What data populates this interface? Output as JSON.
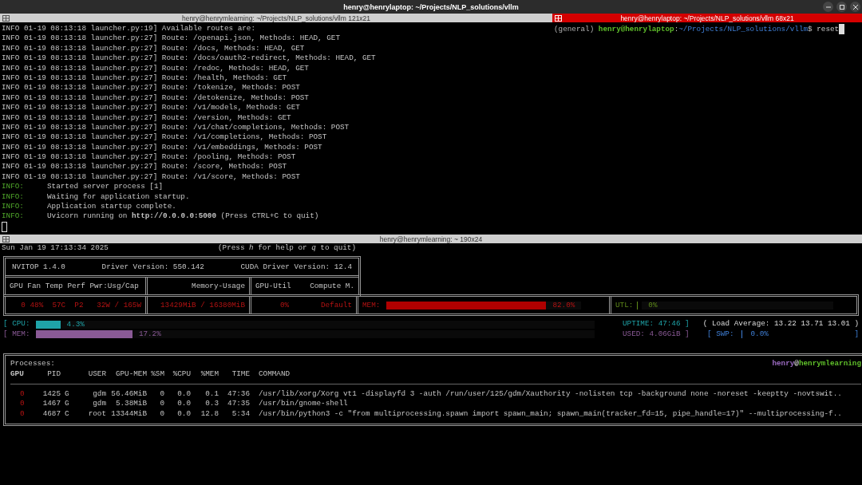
{
  "window": {
    "title": "henry@henrylaptop: ~/Projects/NLP_solutions/vllm"
  },
  "panes": [
    {
      "kind": "log",
      "title": "henry@henrymlearning: ~/Projects/NLP_solutions/vllm 121x21",
      "active": false,
      "lines": [
        {
          "kind": "log",
          "text": "INFO 01-19 08:13:18 launcher.py:19] Available routes are:"
        },
        {
          "kind": "log",
          "text": "INFO 01-19 08:13:18 launcher.py:27] Route: /openapi.json, Methods: HEAD, GET"
        },
        {
          "kind": "log",
          "text": "INFO 01-19 08:13:18 launcher.py:27] Route: /docs, Methods: HEAD, GET"
        },
        {
          "kind": "log",
          "text": "INFO 01-19 08:13:18 launcher.py:27] Route: /docs/oauth2-redirect, Methods: HEAD, GET"
        },
        {
          "kind": "log",
          "text": "INFO 01-19 08:13:18 launcher.py:27] Route: /redoc, Methods: HEAD, GET"
        },
        {
          "kind": "log",
          "text": "INFO 01-19 08:13:18 launcher.py:27] Route: /health, Methods: GET"
        },
        {
          "kind": "log",
          "text": "INFO 01-19 08:13:18 launcher.py:27] Route: /tokenize, Methods: POST"
        },
        {
          "kind": "log",
          "text": "INFO 01-19 08:13:18 launcher.py:27] Route: /detokenize, Methods: POST"
        },
        {
          "kind": "log",
          "text": "INFO 01-19 08:13:18 launcher.py:27] Route: /v1/models, Methods: GET"
        },
        {
          "kind": "log",
          "text": "INFO 01-19 08:13:18 launcher.py:27] Route: /version, Methods: GET"
        },
        {
          "kind": "log",
          "text": "INFO 01-19 08:13:18 launcher.py:27] Route: /v1/chat/completions, Methods: POST"
        },
        {
          "kind": "log",
          "text": "INFO 01-19 08:13:18 launcher.py:27] Route: /v1/completions, Methods: POST"
        },
        {
          "kind": "log",
          "text": "INFO 01-19 08:13:18 launcher.py:27] Route: /v1/embeddings, Methods: POST"
        },
        {
          "kind": "log",
          "text": "INFO 01-19 08:13:18 launcher.py:27] Route: /pooling, Methods: POST"
        },
        {
          "kind": "log",
          "text": "INFO 01-19 08:13:18 launcher.py:27] Route: /score, Methods: POST"
        },
        {
          "kind": "log",
          "text": "INFO 01-19 08:13:18 launcher.py:27] Route: /v1/score, Methods: POST"
        },
        {
          "kind": "server",
          "tag": "INFO:",
          "text": "Started server process [1]"
        },
        {
          "kind": "server",
          "tag": "INFO:",
          "text": "Waiting for application startup."
        },
        {
          "kind": "server",
          "tag": "INFO:",
          "text": "Application startup complete."
        },
        {
          "kind": "server",
          "tag": "INFO:",
          "text": "Uvicorn running on **http://0.0.0.0:5000** (Press CTRL+C to quit)"
        }
      ]
    },
    {
      "kind": "shell",
      "title": "henry@henrylaptop: ~/Projects/NLP_solutions/vllm 68x21",
      "active": true,
      "prompt": {
        "env": "(general)",
        "user_host": "henry@henrylaptop",
        "separator": ":",
        "path": "~/Projects/NLP_solutions/vllm",
        "symbol": "$",
        "command": "reset"
      }
    }
  ],
  "monitor": {
    "title": "henry@henrymlearning: ~ 190x24",
    "active": false,
    "clock": "Sun Jan 19 17:13:34 2025",
    "help": "(Press *h* for help or *q* to quit)",
    "summary": {
      "version": "NVITOP 1.4.0",
      "driver": "Driver Version: 550.142",
      "cuda": "CUDA Driver Version: 12.4"
    },
    "gpu_columns": {
      "status": "GPU Fan Temp Perf Pwr:Usg/Cap",
      "memory": "Memory-Usage",
      "util": "GPU-Util",
      "compute": "Compute M."
    },
    "gpu": {
      "status": "0 48%  57C  P2   32W / 165W",
      "memory": "13429MiB / 16380MiB",
      "util": "0%",
      "compute": "Default",
      "mem_meter": {
        "label": "MEM:",
        "level": 0.82,
        "reading": "82.0%"
      },
      "util_meter": {
        "label": "UTL:",
        "level": 0,
        "reading": "0%"
      }
    },
    "host_meters": [
      {
        "kind": "cpu",
        "label": "[ CPU:",
        "level": 0.043,
        "reading": "4.3%"
      },
      {
        "kind": "mem",
        "label": "[ MEM:",
        "level": 0.172,
        "reading": "17.2%"
      }
    ],
    "host_stats": {
      "uptime": "UPTIME: 47:46 ]",
      "load": "( Load Average: 13.22 13.71 13.01 )",
      "used": "USED: 4.06GiB ]",
      "swap": {
        "label": "[ SWP:",
        "reading": "0.0%",
        "end": "]"
      }
    },
    "processes": {
      "title": "Processes:",
      "user": "henry",
      "separator": "@",
      "host": "henrymlearning",
      "columns": [
        "GPU",
        "PID",
        "USER",
        "GPU-MEM",
        "%SM",
        "%CPU",
        "%MEM",
        "TIME",
        "COMMAND"
      ],
      "rows": [
        {
          "gpu": "0",
          "pid": "1425",
          "type": "G",
          "user": "gdm",
          "gpu_mem": "56.46MiB",
          "sm": "0",
          "cpu": "0.0",
          "mem": "0.1",
          "time": "47:36",
          "command": "/usr/lib/xorg/Xorg vt1 -displayfd 3 -auth /run/user/125/gdm/Xauthority -nolisten tcp -background none -noreset -keeptty -novtswit.."
        },
        {
          "gpu": "0",
          "pid": "1467",
          "type": "G",
          "user": "gdm",
          "gpu_mem": "5.38MiB",
          "sm": "0",
          "cpu": "0.0",
          "mem": "0.3",
          "time": "47:35",
          "command": "/usr/bin/gnome-shell"
        },
        {
          "gpu": "0",
          "pid": "4687",
          "type": "C",
          "user": "root",
          "gpu_mem": "13344MiB",
          "sm": "0",
          "cpu": "0.0",
          "mem": "12.8",
          "time": "5:34",
          "command": "/usr/bin/python3 -c \"from multiprocessing.spawn import spawn_main; spawn_main(tracker_fd=15, pipe_handle=17)\" --multiprocessing-f.."
        }
      ]
    }
  }
}
